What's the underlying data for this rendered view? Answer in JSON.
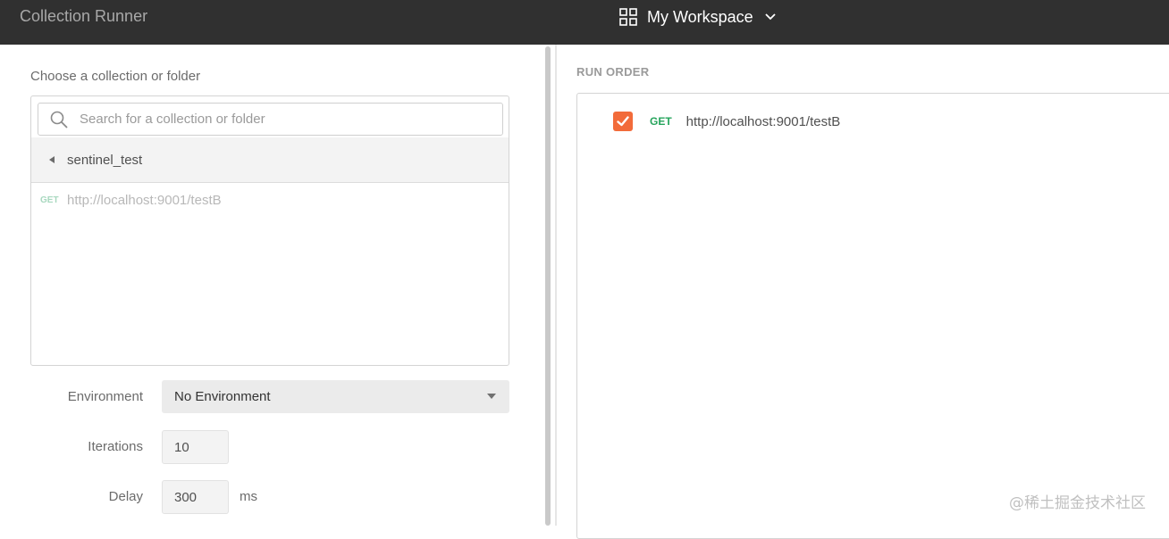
{
  "titlebar": {
    "app_title": "Collection Runner",
    "workspace_label": "My Workspace",
    "workspace_icon": "grid-icon",
    "dropdown_icon": "chevron-down-icon"
  },
  "left": {
    "choose_label": "Choose a collection or folder",
    "search": {
      "placeholder": "Search for a collection or folder",
      "value": ""
    },
    "breadcrumb": {
      "label": "sentinel_test",
      "icon": "caret-left-icon"
    },
    "requests": [
      {
        "method": "GET",
        "url": "http://localhost:9001/testB"
      }
    ],
    "environment": {
      "label": "Environment",
      "value": "No Environment"
    },
    "iterations": {
      "label": "Iterations",
      "value": "10"
    },
    "delay": {
      "label": "Delay",
      "value": "300",
      "unit": "ms"
    }
  },
  "right": {
    "run_order_label": "RUN ORDER",
    "items": [
      {
        "checked": true,
        "method": "GET",
        "url": "http://localhost:9001/testB"
      }
    ]
  },
  "watermark": "@稀土掘金技术社区",
  "colors": {
    "titlebar_bg": "#303030",
    "accent_orange": "#f26b3a",
    "get_green": "#26a45c"
  }
}
